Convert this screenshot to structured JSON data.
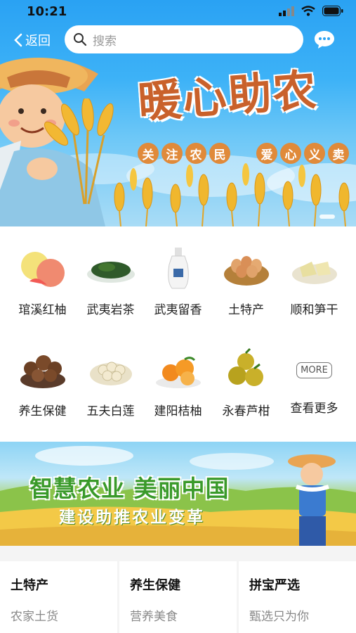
{
  "status_bar": {
    "time": "10:21"
  },
  "header": {
    "back_label": "返回",
    "search_placeholder": "搜索"
  },
  "hero": {
    "title": "暖心助农",
    "tags_left": [
      "关",
      "注",
      "农",
      "民"
    ],
    "tags_right": [
      "爱",
      "心",
      "义",
      "卖"
    ]
  },
  "categories": [
    {
      "label": "琯溪红柚",
      "icon": "pomelo-icon"
    },
    {
      "label": "武夷岩茶",
      "icon": "tea-icon"
    },
    {
      "label": "武夷留香",
      "icon": "liquor-bottle-icon"
    },
    {
      "label": "土特产",
      "icon": "eggs-basket-icon"
    },
    {
      "label": "顺和笋干",
      "icon": "dried-bamboo-icon"
    },
    {
      "label": "养生保健",
      "icon": "mushroom-icon"
    },
    {
      "label": "五夫白莲",
      "icon": "lotus-seed-icon"
    },
    {
      "label": "建阳桔柚",
      "icon": "orange-icon"
    },
    {
      "label": "永春芦柑",
      "icon": "citrus-icon"
    },
    {
      "label": "查看更多",
      "icon": "more-icon",
      "icon_text": "MORE"
    }
  ],
  "banner": {
    "headline": "智慧农业 美丽中国",
    "subline": "建设助推农业变革"
  },
  "tiles": [
    {
      "title": "土特产",
      "subtitle": "农家土货"
    },
    {
      "title": "养生保健",
      "subtitle": "营养美食"
    },
    {
      "title": "拼宝严选",
      "subtitle": "甄选只为你"
    }
  ],
  "colors": {
    "sky": "#2aa2f3",
    "title_brown": "#c9612b",
    "chip_orange": "#e08a3a",
    "banner_green": "#3a9a2a"
  }
}
